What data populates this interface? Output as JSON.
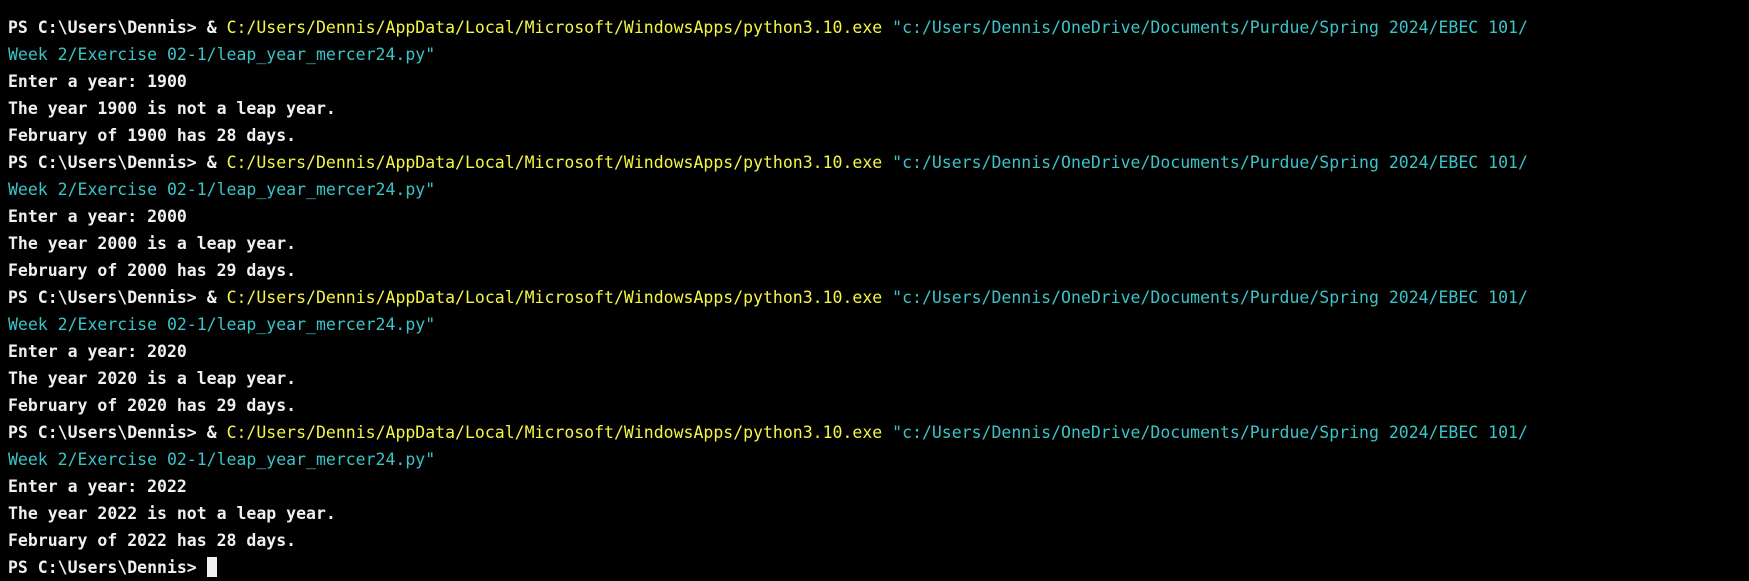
{
  "terminal": {
    "colors": {
      "background": "#000000",
      "text": "#f0f0f0",
      "executable": "#f5f543",
      "argument": "#3bc4c8"
    },
    "prompt": "PS C:\\Users\\Dennis> ",
    "operator": "& ",
    "executable": "C:/Users/Dennis/AppData/Local/Microsoft/WindowsApps/python3.10.exe",
    "argument": " \"c:/Users/Dennis/OneDrive/Documents/Purdue/Spring 2024/EBEC 101/Week 2/Exercise 02-1/leap_year_mercer24.py\"",
    "runs": [
      {
        "input": "Enter a year: 1900",
        "result": "The year 1900 is not a leap year.",
        "days": "February of 1900 has 28 days."
      },
      {
        "input": "Enter a year: 2000",
        "result": "The year 2000 is a leap year.",
        "days": "February of 2000 has 29 days."
      },
      {
        "input": "Enter a year: 2020",
        "result": "The year 2020 is a leap year.",
        "days": "February of 2020 has 29 days."
      },
      {
        "input": "Enter a year: 2022",
        "result": "The year 2022 is not a leap year.",
        "days": "February of 2022 has 28 days."
      }
    ],
    "final_prompt": "PS C:\\Users\\Dennis> "
  }
}
